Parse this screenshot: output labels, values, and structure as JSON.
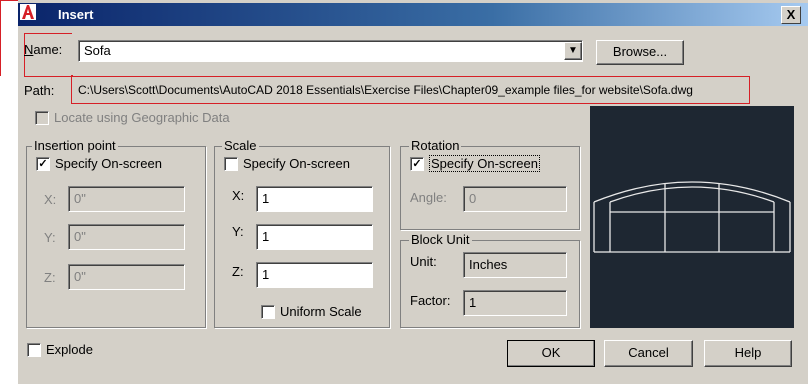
{
  "window": {
    "title": "Insert",
    "close_glyph": "X"
  },
  "name_row": {
    "label": "Name:",
    "value": "Sofa",
    "browse_label": "Browse..."
  },
  "path_row": {
    "label": "Path:",
    "value": "C:\\Users\\Scott\\Documents\\AutoCAD 2018 Essentials\\Exercise Files\\Chapter09_example files_for website\\Sofa.dwg"
  },
  "geo": {
    "label": "Locate using Geographic Data"
  },
  "insertion": {
    "title": "Insertion point",
    "specify_label": "Specify On-screen",
    "specify_checked": "✓",
    "x_label": "X:",
    "x_value": "0\"",
    "y_label": "Y:",
    "y_value": "0\"",
    "z_label": "Z:",
    "z_value": "0\""
  },
  "scale": {
    "title": "Scale",
    "specify_label": "Specify On-screen",
    "x_label": "X:",
    "x_value": "1",
    "y_label": "Y:",
    "y_value": "1",
    "z_label": "Z:",
    "z_value": "1",
    "uniform_label": "Uniform Scale"
  },
  "rotation": {
    "title": "Rotation",
    "specify_label": "Specify On-screen",
    "specify_checked": "✓",
    "angle_label": "Angle:",
    "angle_value": "0"
  },
  "block_unit": {
    "title": "Block Unit",
    "unit_label": "Unit:",
    "unit_value": "Inches",
    "factor_label": "Factor:",
    "factor_value": "1"
  },
  "explode": {
    "label": "Explode"
  },
  "buttons": {
    "ok": "OK",
    "cancel": "Cancel",
    "help": "Help"
  },
  "colors": {
    "dialog_bg": "#d4d0c8",
    "title_bar": "#0a246a",
    "highlight": "#d61f26",
    "preview_bg": "#1e2732"
  }
}
